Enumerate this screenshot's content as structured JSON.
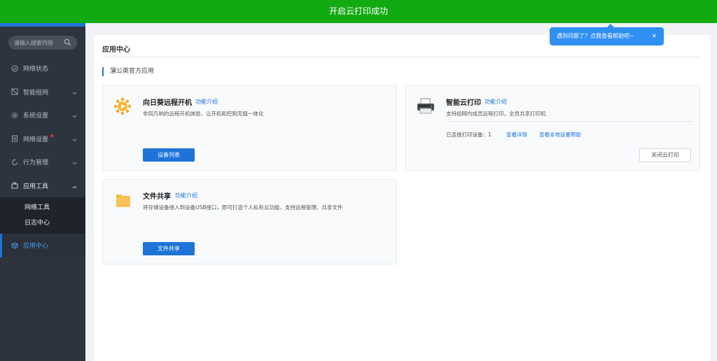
{
  "topbar": {
    "message": "开启云打印成功"
  },
  "sidebar": {
    "search_placeholder": "请输入搜索内容",
    "items": [
      {
        "label": "网络状态"
      },
      {
        "label": "智能组网"
      },
      {
        "label": "系统设置"
      },
      {
        "label": "网络设置"
      },
      {
        "label": "行为管理"
      },
      {
        "label": "应用工具"
      }
    ],
    "submenu": [
      {
        "label": "网络工具"
      },
      {
        "label": "日志中心"
      }
    ],
    "active": {
      "label": "应用中心"
    }
  },
  "main": {
    "page_title": "应用中心",
    "section_title": "蒲公英官方应用",
    "cards": [
      {
        "title": "向日葵远程开机",
        "link": "功能介绍",
        "desc": "非同凡响的远程开机体验，让开机和控制无缝一体化",
        "button": "设备列表"
      },
      {
        "title": "智能云打印",
        "link": "功能介绍",
        "desc": "支持组网内成员远程打印，全员共享打印机",
        "stat": "已连接打印设备：1",
        "link_details": "查看详情",
        "link_help": "查看本地设置帮助",
        "button": "关闭云打印"
      },
      {
        "title": "文件共享",
        "link": "功能介绍",
        "desc": "将存储设备接入到设备USB接口，即可打造个人私有云功能，支持远程管理、共享文件",
        "button": "文件共享"
      }
    ]
  },
  "tooltip": {
    "text": "遇到问题了？点我查看帮助吧~",
    "close": "×"
  },
  "colors": {
    "topbar": "#12aa12",
    "accent": "#1e73d8",
    "sidebar": "#2e343e",
    "tooltip": "#2f8ff2"
  }
}
